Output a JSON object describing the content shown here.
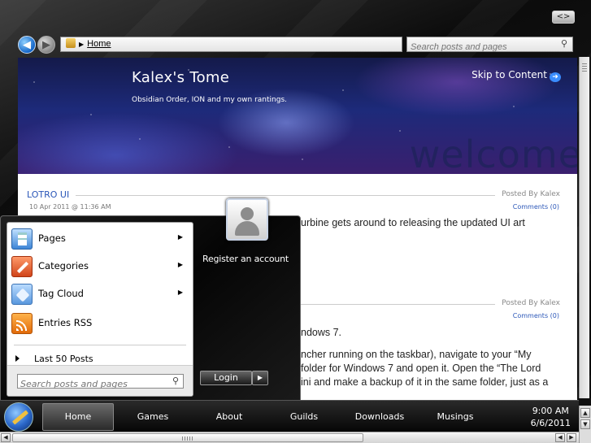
{
  "window": {
    "controls_label": "<>"
  },
  "address": {
    "crumb": "Home"
  },
  "search": {
    "placeholder": "Search posts and pages"
  },
  "banner": {
    "title": "Kalex's Tome",
    "tagline": "Obsidian Order, ION and my own rantings.",
    "skip_label": "Skip to Content",
    "watermark": "welcome"
  },
  "posts": [
    {
      "title": "LOTRO UI",
      "posted_by": "Posted By Kalex",
      "date": "10 Apr 2011 @ 11:36 AM",
      "comments": "Comments (0)",
      "body_tail": "urbine gets around to releasing the updated UI art"
    },
    {
      "posted_by": "Posted By Kalex",
      "comments": "Comments (0)",
      "line1_tail": "ndows 7.",
      "line2_tail": "ncher running on the taskbar), navigate to your “My",
      "line3_tail": "folder for Windows 7 and open it.  Open the “The Lord",
      "line4_tail": "ini and make a backup of it in the same folder, just as a"
    }
  ],
  "start_menu": {
    "items": [
      {
        "label": "Pages",
        "icon": "pages-icon"
      },
      {
        "label": "Categories",
        "icon": "categories-icon"
      },
      {
        "label": "Tag Cloud",
        "icon": "tag-cloud-icon"
      },
      {
        "label": "Entries RSS",
        "icon": "rss-icon"
      }
    ],
    "last_posts": "Last 50 Posts",
    "search_placeholder": "Search posts and pages",
    "register": "Register an account",
    "login": "Login"
  },
  "taskbar": {
    "items": [
      "Home",
      "Games",
      "About",
      "Guilds",
      "Downloads",
      "Musings"
    ],
    "time": "9:00 AM",
    "date": "6/6/2011"
  }
}
